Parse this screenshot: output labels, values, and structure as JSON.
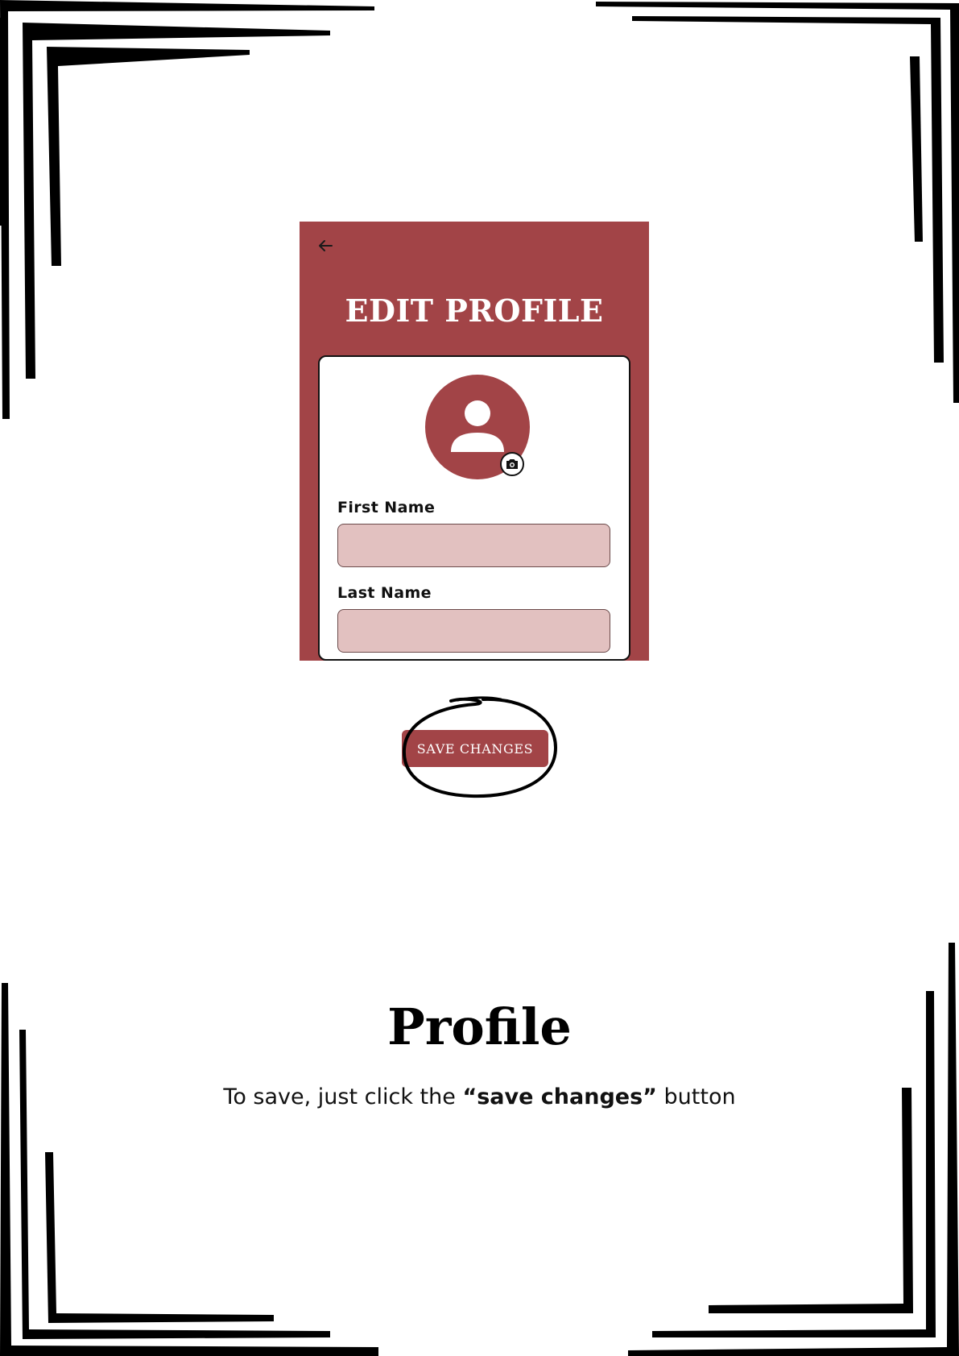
{
  "screen": {
    "title": "EDIT PROFILE",
    "back_icon": "arrow-left-icon",
    "avatar_icon": "user-icon",
    "camera_icon": "camera-icon",
    "fields": [
      {
        "label": "First Name",
        "value": "",
        "placeholder": ""
      },
      {
        "label": "Last Name",
        "value": "",
        "placeholder": ""
      }
    ],
    "save_label": "SAVE CHANGES"
  },
  "caption": {
    "heading": "Profile",
    "text_before": "To save, just click the ",
    "text_bold": "“save changes”",
    "text_after": " button"
  },
  "colors": {
    "accent": "#a24447",
    "input_fill": "#e2c1c0",
    "background": "#ffffff",
    "frame": "#000000"
  }
}
